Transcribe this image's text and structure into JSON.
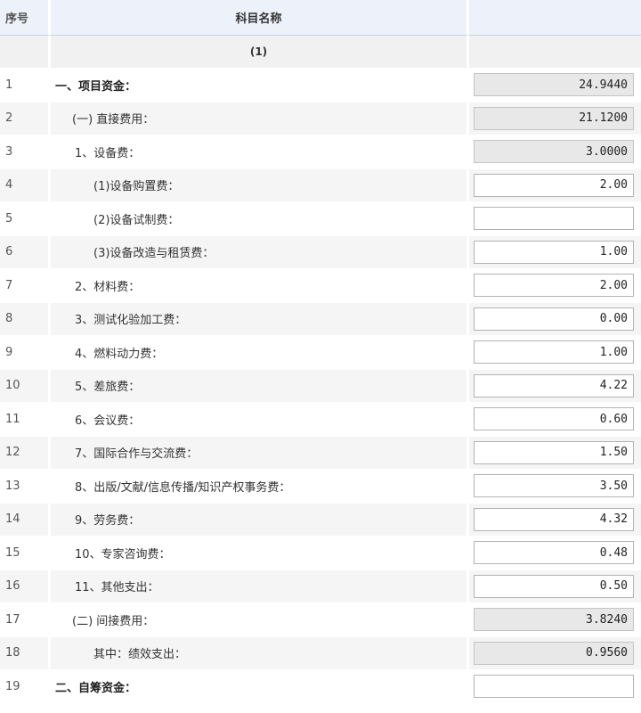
{
  "header": {
    "col_no": "序号",
    "col_name": "科目名称"
  },
  "subheader": {
    "label": "(1)"
  },
  "rows": [
    {
      "no": "1",
      "name": "一、项目资金：",
      "value": "24.9440",
      "readonly": true,
      "level": 0
    },
    {
      "no": "2",
      "name": "(一) 直接费用：",
      "value": "21.1200",
      "readonly": true,
      "level": 1
    },
    {
      "no": "3",
      "name": "1、设备费：",
      "value": "3.0000",
      "readonly": true,
      "level": 2
    },
    {
      "no": "4",
      "name": "(1)设备购置费：",
      "value": "2.00",
      "readonly": false,
      "level": 3
    },
    {
      "no": "5",
      "name": "(2)设备试制费：",
      "value": "",
      "readonly": false,
      "level": 3
    },
    {
      "no": "6",
      "name": "(3)设备改造与租赁费：",
      "value": "1.00",
      "readonly": false,
      "level": 3
    },
    {
      "no": "7",
      "name": "2、材料费：",
      "value": "2.00",
      "readonly": false,
      "level": 2
    },
    {
      "no": "8",
      "name": "3、测试化验加工费：",
      "value": "0.00",
      "readonly": false,
      "level": 2
    },
    {
      "no": "9",
      "name": "4、燃料动力费：",
      "value": "1.00",
      "readonly": false,
      "level": 2
    },
    {
      "no": "10",
      "name": "5、差旅费：",
      "value": "4.22",
      "readonly": false,
      "level": 2
    },
    {
      "no": "11",
      "name": "6、会议费：",
      "value": "0.60",
      "readonly": false,
      "level": 2
    },
    {
      "no": "12",
      "name": "7、国际合作与交流费：",
      "value": "1.50",
      "readonly": false,
      "level": 2
    },
    {
      "no": "13",
      "name": "8、出版/文献/信息传播/知识产权事务费：",
      "value": "3.50",
      "readonly": false,
      "level": 2
    },
    {
      "no": "14",
      "name": "9、劳务费：",
      "value": "4.32",
      "readonly": false,
      "level": 2
    },
    {
      "no": "15",
      "name": "10、专家咨询费：",
      "value": "0.48",
      "readonly": false,
      "level": 2
    },
    {
      "no": "16",
      "name": "11、其他支出：",
      "value": "0.50",
      "readonly": false,
      "level": 2
    },
    {
      "no": "17",
      "name": "(二) 间接费用：",
      "value": "3.8240",
      "readonly": true,
      "level": 1
    },
    {
      "no": "18",
      "name": "其中：绩效支出：",
      "value": "0.9560",
      "readonly": true,
      "level": 3
    },
    {
      "no": "19",
      "name": "二、自筹资金：",
      "value": "",
      "readonly": false,
      "level": 0
    }
  ]
}
